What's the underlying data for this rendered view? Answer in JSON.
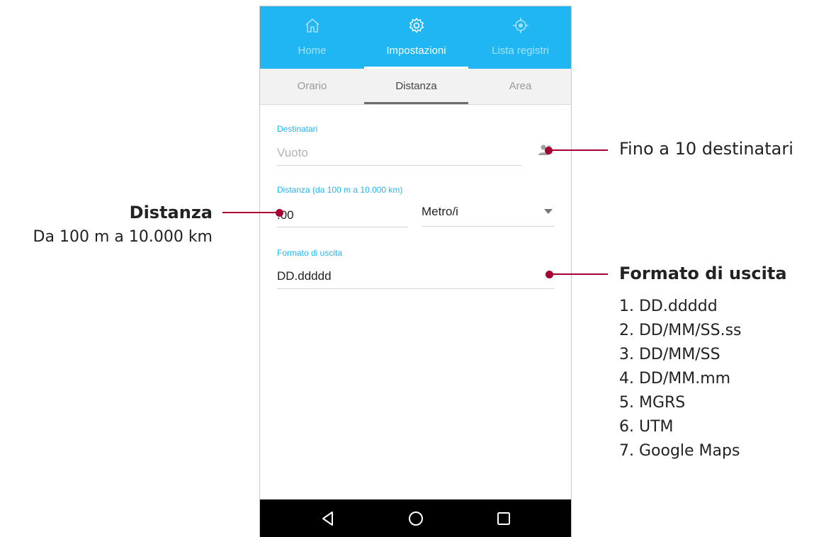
{
  "colors": {
    "accent": "#1fb6f3",
    "annotation": "#a50034",
    "navbar": "#000000"
  },
  "top_tabs": [
    {
      "label": "Home",
      "icon": "home-icon"
    },
    {
      "label": "Impostazioni",
      "icon": "gear-icon"
    },
    {
      "label": "Lista registri",
      "icon": "crosshair-icon"
    }
  ],
  "top_tabs_active": "Impostazioni",
  "sub_tabs": [
    {
      "label": "Orario"
    },
    {
      "label": "Distanza"
    },
    {
      "label": "Area"
    }
  ],
  "sub_tabs_active": "Distanza",
  "form": {
    "recipients": {
      "label": "Destinatari",
      "placeholder": "Vuoto",
      "icon": "contacts-icon"
    },
    "distance": {
      "label": "Distanza (da 100 m a 10.000 km)",
      "value": ".00",
      "unit": "Metro/i",
      "unit_icon": "dropdown-arrow-icon"
    },
    "output_format": {
      "label": "Formato di uscita",
      "value": "DD.ddddd"
    }
  },
  "nav_bar": {
    "back": "back-icon",
    "home": "home-circle-icon",
    "recents": "recents-icon"
  },
  "annotations": {
    "recipients": "Fino a 10 destinatari",
    "distance_title": "Distanza",
    "distance_range": "Da 100 m a 10.000 km",
    "format_title": "Formato di uscita",
    "format_list": [
      "1. DD.ddddd",
      "2. DD/MM/SS.ss",
      "3. DD/MM/SS",
      "4. DD/MM.mm",
      "5. MGRS",
      "6. UTM",
      "7. Google Maps"
    ]
  }
}
